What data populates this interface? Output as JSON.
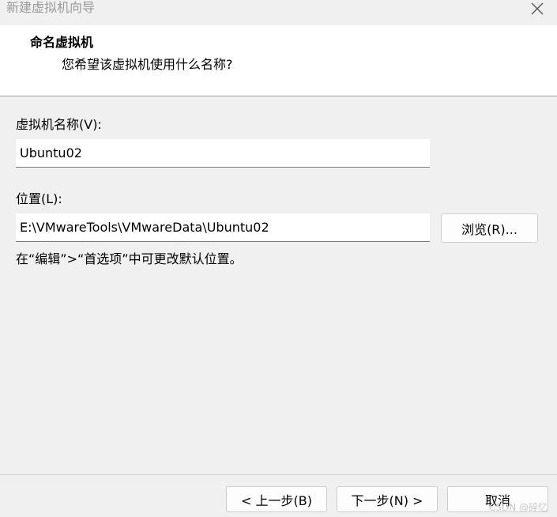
{
  "window": {
    "title": "新建虚拟机向导",
    "close_icon": "close-icon"
  },
  "header": {
    "title": "命名虚拟机",
    "subtitle": "您希望该虚拟机使用什么名称?"
  },
  "form": {
    "name_label": "虚拟机名称(V):",
    "name_value": "Ubuntu02",
    "location_label": "位置(L):",
    "location_value": "E:\\VMwareTools\\VMwareData\\Ubuntu02",
    "browse_label": "浏览(R)...",
    "hint": "在“编辑”>“首选项”中可更改默认位置。"
  },
  "footer": {
    "back_label": "< 上一步(B)",
    "next_label": "下一步(N) >",
    "cancel_label": "取消",
    "watermark": "CSDN @碎忆"
  }
}
